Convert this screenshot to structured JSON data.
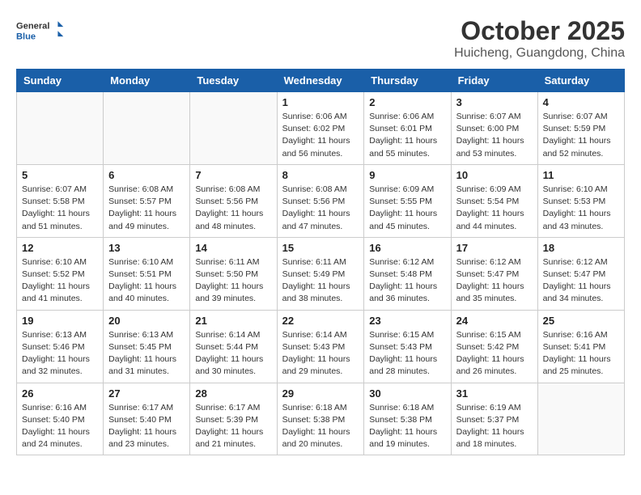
{
  "header": {
    "logo_general": "General",
    "logo_blue": "Blue",
    "main_title": "October 2025",
    "subtitle": "Huicheng, Guangdong, China"
  },
  "weekdays": [
    "Sunday",
    "Monday",
    "Tuesday",
    "Wednesday",
    "Thursday",
    "Friday",
    "Saturday"
  ],
  "weeks": [
    [
      {
        "day": "",
        "info": ""
      },
      {
        "day": "",
        "info": ""
      },
      {
        "day": "",
        "info": ""
      },
      {
        "day": "1",
        "info": "Sunrise: 6:06 AM\nSunset: 6:02 PM\nDaylight: 11 hours\nand 56 minutes."
      },
      {
        "day": "2",
        "info": "Sunrise: 6:06 AM\nSunset: 6:01 PM\nDaylight: 11 hours\nand 55 minutes."
      },
      {
        "day": "3",
        "info": "Sunrise: 6:07 AM\nSunset: 6:00 PM\nDaylight: 11 hours\nand 53 minutes."
      },
      {
        "day": "4",
        "info": "Sunrise: 6:07 AM\nSunset: 5:59 PM\nDaylight: 11 hours\nand 52 minutes."
      }
    ],
    [
      {
        "day": "5",
        "info": "Sunrise: 6:07 AM\nSunset: 5:58 PM\nDaylight: 11 hours\nand 51 minutes."
      },
      {
        "day": "6",
        "info": "Sunrise: 6:08 AM\nSunset: 5:57 PM\nDaylight: 11 hours\nand 49 minutes."
      },
      {
        "day": "7",
        "info": "Sunrise: 6:08 AM\nSunset: 5:56 PM\nDaylight: 11 hours\nand 48 minutes."
      },
      {
        "day": "8",
        "info": "Sunrise: 6:08 AM\nSunset: 5:56 PM\nDaylight: 11 hours\nand 47 minutes."
      },
      {
        "day": "9",
        "info": "Sunrise: 6:09 AM\nSunset: 5:55 PM\nDaylight: 11 hours\nand 45 minutes."
      },
      {
        "day": "10",
        "info": "Sunrise: 6:09 AM\nSunset: 5:54 PM\nDaylight: 11 hours\nand 44 minutes."
      },
      {
        "day": "11",
        "info": "Sunrise: 6:10 AM\nSunset: 5:53 PM\nDaylight: 11 hours\nand 43 minutes."
      }
    ],
    [
      {
        "day": "12",
        "info": "Sunrise: 6:10 AM\nSunset: 5:52 PM\nDaylight: 11 hours\nand 41 minutes."
      },
      {
        "day": "13",
        "info": "Sunrise: 6:10 AM\nSunset: 5:51 PM\nDaylight: 11 hours\nand 40 minutes."
      },
      {
        "day": "14",
        "info": "Sunrise: 6:11 AM\nSunset: 5:50 PM\nDaylight: 11 hours\nand 39 minutes."
      },
      {
        "day": "15",
        "info": "Sunrise: 6:11 AM\nSunset: 5:49 PM\nDaylight: 11 hours\nand 38 minutes."
      },
      {
        "day": "16",
        "info": "Sunrise: 6:12 AM\nSunset: 5:48 PM\nDaylight: 11 hours\nand 36 minutes."
      },
      {
        "day": "17",
        "info": "Sunrise: 6:12 AM\nSunset: 5:47 PM\nDaylight: 11 hours\nand 35 minutes."
      },
      {
        "day": "18",
        "info": "Sunrise: 6:12 AM\nSunset: 5:47 PM\nDaylight: 11 hours\nand 34 minutes."
      }
    ],
    [
      {
        "day": "19",
        "info": "Sunrise: 6:13 AM\nSunset: 5:46 PM\nDaylight: 11 hours\nand 32 minutes."
      },
      {
        "day": "20",
        "info": "Sunrise: 6:13 AM\nSunset: 5:45 PM\nDaylight: 11 hours\nand 31 minutes."
      },
      {
        "day": "21",
        "info": "Sunrise: 6:14 AM\nSunset: 5:44 PM\nDaylight: 11 hours\nand 30 minutes."
      },
      {
        "day": "22",
        "info": "Sunrise: 6:14 AM\nSunset: 5:43 PM\nDaylight: 11 hours\nand 29 minutes."
      },
      {
        "day": "23",
        "info": "Sunrise: 6:15 AM\nSunset: 5:43 PM\nDaylight: 11 hours\nand 28 minutes."
      },
      {
        "day": "24",
        "info": "Sunrise: 6:15 AM\nSunset: 5:42 PM\nDaylight: 11 hours\nand 26 minutes."
      },
      {
        "day": "25",
        "info": "Sunrise: 6:16 AM\nSunset: 5:41 PM\nDaylight: 11 hours\nand 25 minutes."
      }
    ],
    [
      {
        "day": "26",
        "info": "Sunrise: 6:16 AM\nSunset: 5:40 PM\nDaylight: 11 hours\nand 24 minutes."
      },
      {
        "day": "27",
        "info": "Sunrise: 6:17 AM\nSunset: 5:40 PM\nDaylight: 11 hours\nand 23 minutes."
      },
      {
        "day": "28",
        "info": "Sunrise: 6:17 AM\nSunset: 5:39 PM\nDaylight: 11 hours\nand 21 minutes."
      },
      {
        "day": "29",
        "info": "Sunrise: 6:18 AM\nSunset: 5:38 PM\nDaylight: 11 hours\nand 20 minutes."
      },
      {
        "day": "30",
        "info": "Sunrise: 6:18 AM\nSunset: 5:38 PM\nDaylight: 11 hours\nand 19 minutes."
      },
      {
        "day": "31",
        "info": "Sunrise: 6:19 AM\nSunset: 5:37 PM\nDaylight: 11 hours\nand 18 minutes."
      },
      {
        "day": "",
        "info": ""
      }
    ]
  ]
}
